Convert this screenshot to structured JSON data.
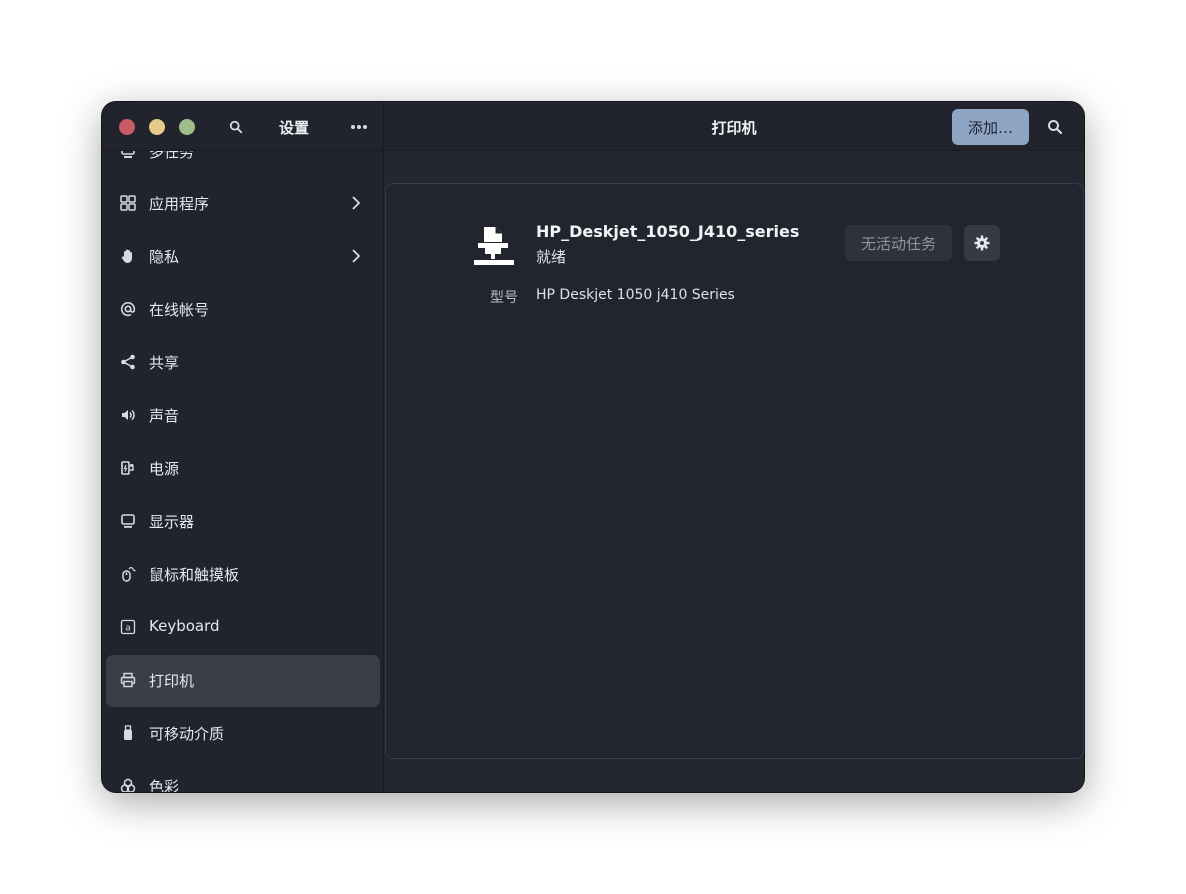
{
  "window": {
    "sidebar_title": "设置",
    "main_title": "打印机",
    "add_button_label": "添加…"
  },
  "sidebar": {
    "items": [
      {
        "label": "多任务",
        "icon": "multitasking-icon",
        "has_arrow": false
      },
      {
        "label": "应用程序",
        "icon": "apps-icon",
        "has_arrow": true
      },
      {
        "label": "隐私",
        "icon": "hand-icon",
        "has_arrow": true
      },
      {
        "label": "在线帐号",
        "icon": "at-icon",
        "has_arrow": false
      },
      {
        "label": "共享",
        "icon": "share-icon",
        "has_arrow": false
      },
      {
        "label": "声音",
        "icon": "speaker-icon",
        "has_arrow": false
      },
      {
        "label": "电源",
        "icon": "power-plug-icon",
        "has_arrow": false
      },
      {
        "label": "显示器",
        "icon": "display-icon",
        "has_arrow": false
      },
      {
        "label": "鼠标和触摸板",
        "icon": "mouse-icon",
        "has_arrow": false
      },
      {
        "label": "Keyboard",
        "icon": "keyboard-icon",
        "has_arrow": false
      },
      {
        "label": "打印机",
        "icon": "printer-icon",
        "has_arrow": false,
        "active": true
      },
      {
        "label": "可移动介质",
        "icon": "usb-drive-icon",
        "has_arrow": false
      },
      {
        "label": "色彩",
        "icon": "color-icon",
        "has_arrow": false
      }
    ]
  },
  "printer": {
    "name": "HP_Deskjet_1050_J410_series",
    "status": "就绪",
    "jobs_button_label": "无活动任务",
    "model_label": "型号",
    "model_value": "HP Deskjet 1050 j410 Series"
  },
  "colors": {
    "window_bg": "#242730",
    "sidebar_bg": "#21242c",
    "accent_button": "#8ea6c4",
    "active_item_bg": "#3a3e48",
    "close_dot": "#c95a66",
    "minimize_dot": "#e7c98b",
    "maximize_dot": "#9fbe8c"
  }
}
